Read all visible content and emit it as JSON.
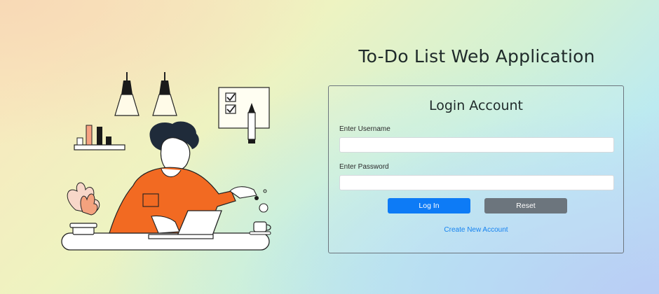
{
  "app": {
    "title": "To-Do List Web Application"
  },
  "login": {
    "heading": "Login Account",
    "username_label": "Enter Username",
    "username_value": "",
    "password_label": "Enter Password",
    "password_value": "",
    "login_button": "Log In",
    "reset_button": "Reset",
    "create_account_link": "Create New Account"
  },
  "colors": {
    "primary": "#0d7bf6",
    "secondary": "#6c757d",
    "link": "#1582f0",
    "illustration_accent": "#f26a22"
  },
  "illustration": {
    "subject": "person-working-at-laptop"
  }
}
